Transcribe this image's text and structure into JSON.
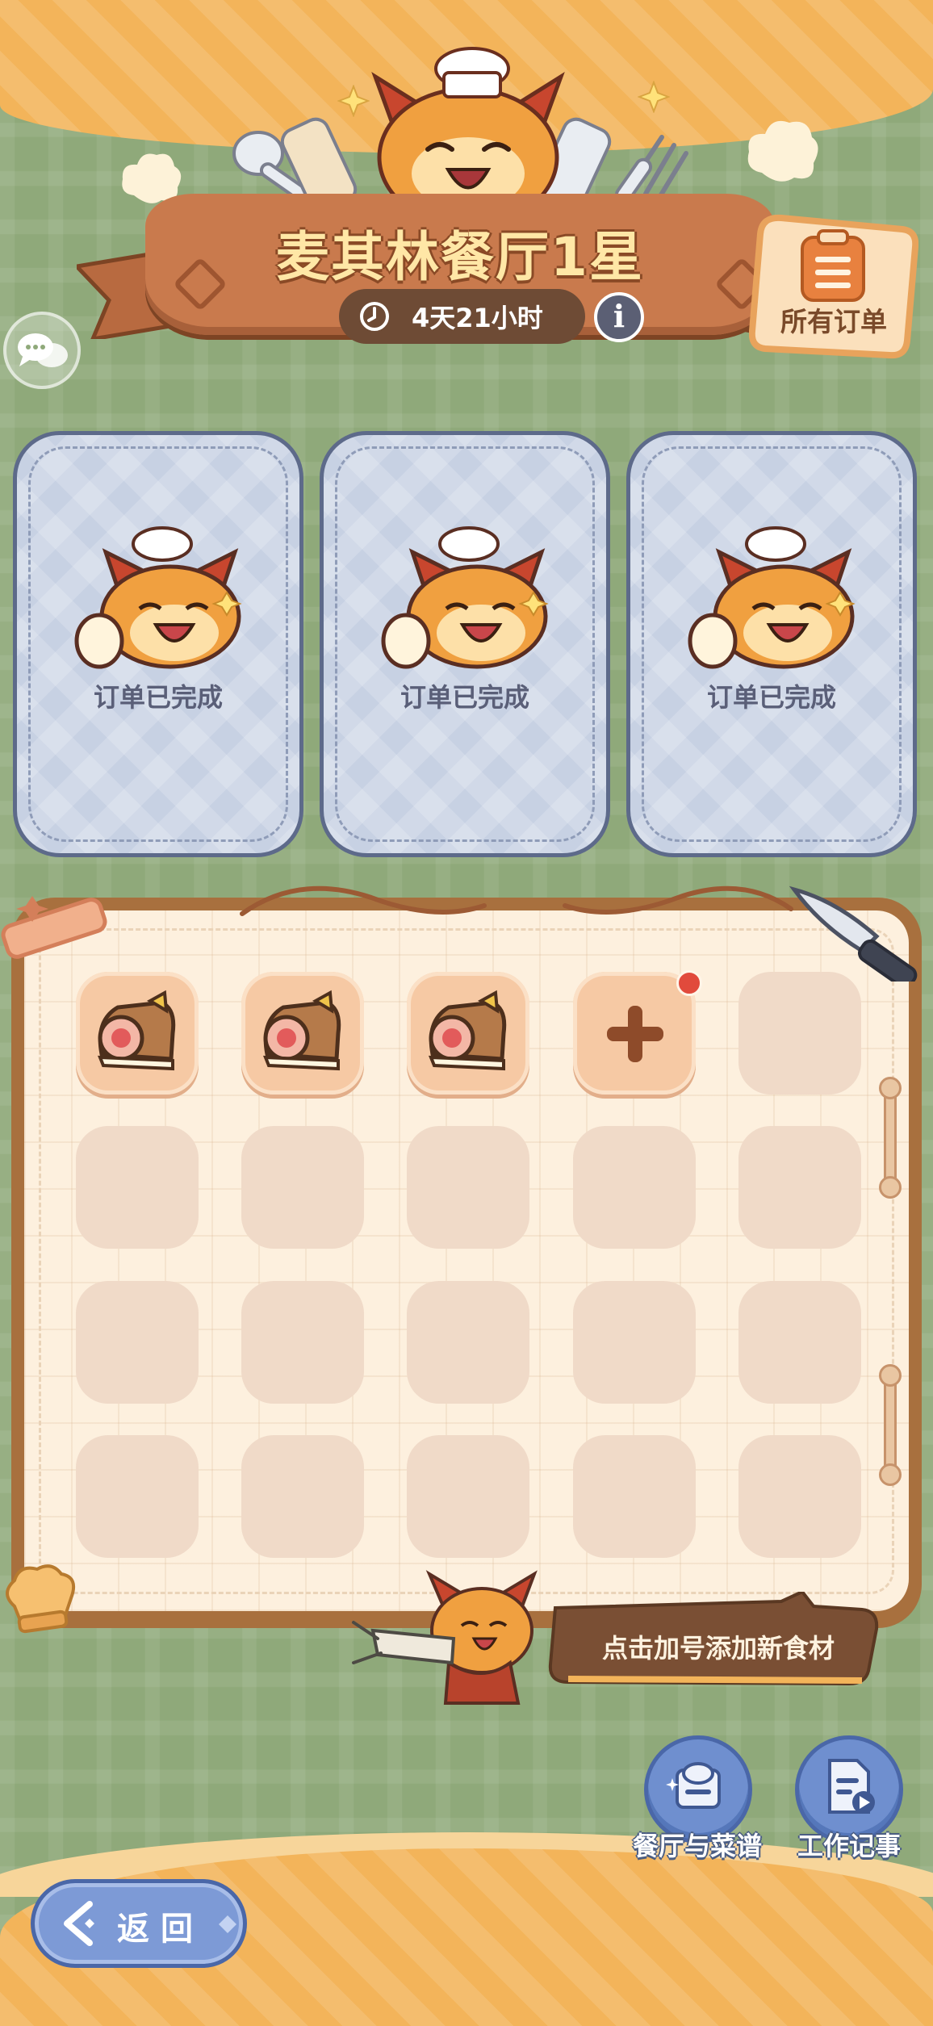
{
  "header": {
    "title": "麦其林餐厅1星",
    "timer": "4天21小时",
    "info_label": "i",
    "all_orders_label": "所有订单"
  },
  "orders": [
    {
      "status": "订单已完成"
    },
    {
      "status": "订单已完成"
    },
    {
      "status": "订单已完成"
    }
  ],
  "ingredients": {
    "slots": [
      {
        "item": "meat-roll"
      },
      {
        "item": "meat-roll"
      },
      {
        "item": "meat-roll"
      },
      {
        "item": "add"
      },
      {
        "item": "empty"
      },
      {
        "item": "empty"
      },
      {
        "item": "empty"
      },
      {
        "item": "empty"
      },
      {
        "item": "empty"
      },
      {
        "item": "empty"
      },
      {
        "item": "empty"
      },
      {
        "item": "empty"
      },
      {
        "item": "empty"
      },
      {
        "item": "empty"
      },
      {
        "item": "empty"
      },
      {
        "item": "empty"
      },
      {
        "item": "empty"
      },
      {
        "item": "empty"
      },
      {
        "item": "empty"
      },
      {
        "item": "empty"
      }
    ]
  },
  "hint": {
    "text": "点击加号添加新食材"
  },
  "bottom_nav": {
    "restaurant_menu_label": "餐厅与菜谱",
    "work_notes_label": "工作记事",
    "back_label": "返回"
  },
  "colors": {
    "background_green": "#8fa97a",
    "ribbon_brown": "#c97a4d",
    "card_blue": "#c7d1e3",
    "board_cream": "#fdf0de",
    "button_blue": "#6f8fcf",
    "notification_red": "#e14a3c"
  },
  "icons": [
    "clock-icon",
    "info-icon",
    "clipboard-icon",
    "chat-icon",
    "meat-roll-icon",
    "plus-icon",
    "recipe-book-icon",
    "notes-icon",
    "back-arrow-icon"
  ]
}
